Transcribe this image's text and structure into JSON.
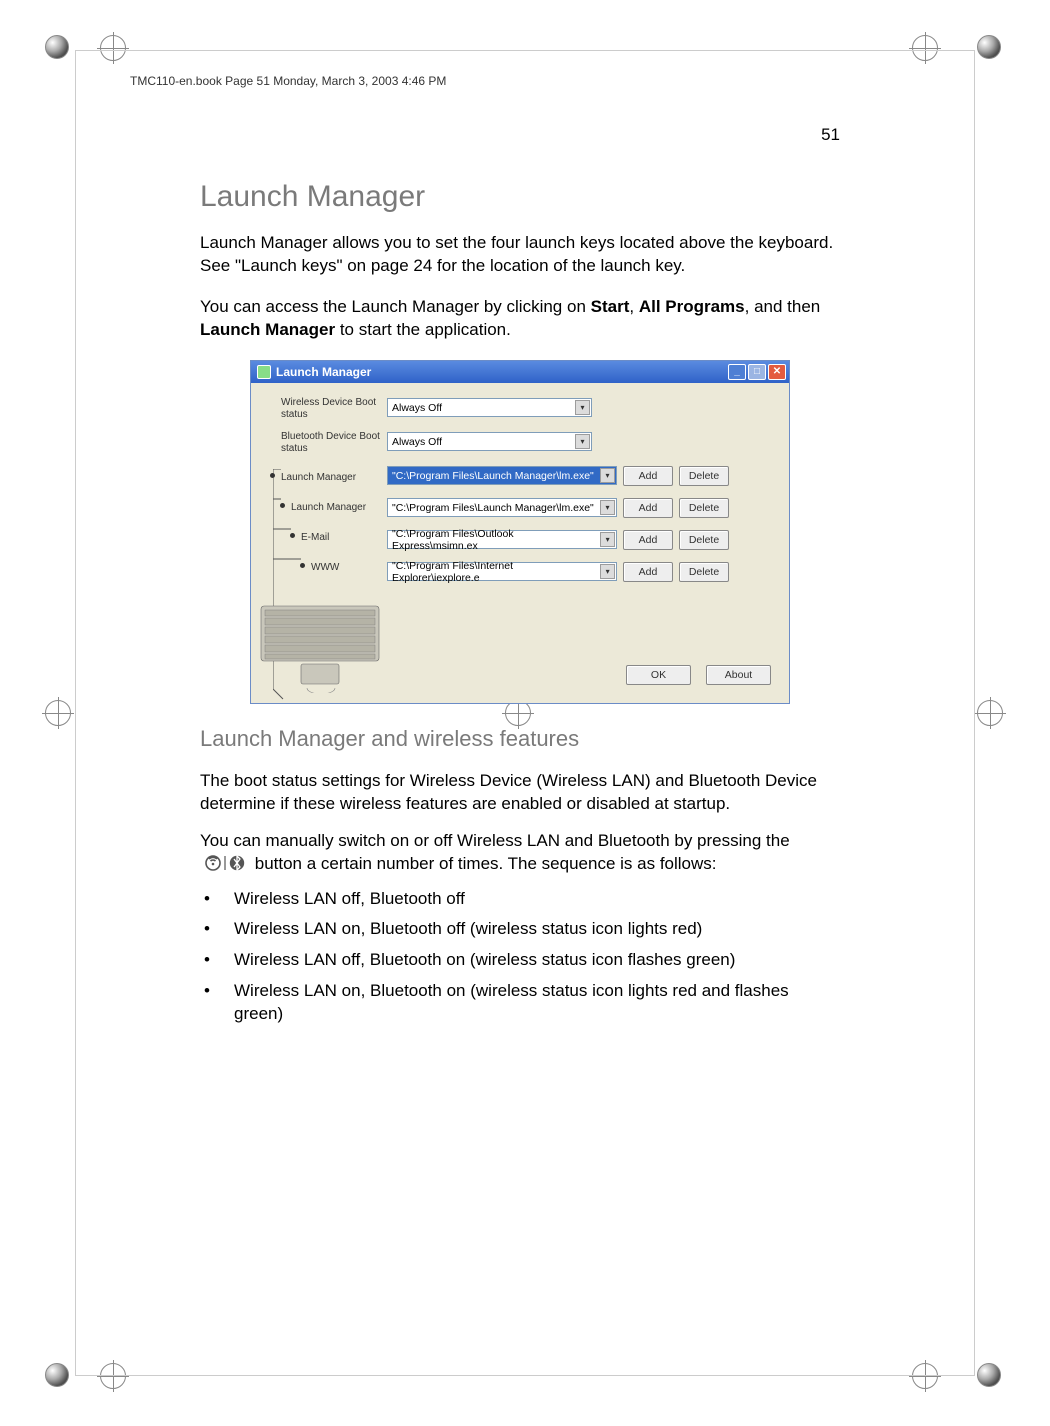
{
  "running_head": "TMC110-en.book  Page 51  Monday, March 3, 2003  4:46 PM",
  "page_number": "51",
  "h1": "Launch Manager",
  "intro_para": "Launch  Manager allows you to set the four launch keys located above the keyboard.  See \"Launch keys\" on page 24 for the location of the launch key.",
  "access_prefix": "You can access the Launch Manager by clicking on ",
  "access_bold1": "Start",
  "access_sep1": ", ",
  "access_bold2": "All Programs",
  "access_sep2": ", and then ",
  "access_bold3": "Launch Manager",
  "access_suffix": " to start the application.",
  "h2": "Launch Manager and wireless features",
  "wireless_para1": "The boot status settings for Wireless Device (Wireless LAN) and Bluetooth Device determine if these wireless features are enabled or disabled at startup.",
  "wireless_para2_prefix": "You can manually switch on or off Wireless LAN and Bluetooth by pressing the ",
  "wireless_para2_suffix": " button a certain number of times. The sequence is as follows:",
  "bullets": [
    "Wireless LAN off, Bluetooth off",
    "Wireless LAN on, Bluetooth off (wireless status icon lights red)",
    "Wireless LAN off, Bluetooth on (wireless status icon flashes green)",
    "Wireless LAN on, Bluetooth on (wireless status icon lights red and flashes green)"
  ],
  "lm": {
    "title": "Launch Manager",
    "labels": {
      "wireless_boot": "Wireless Device Boot status",
      "bt_boot": "Bluetooth Device Boot status",
      "keys": [
        "Launch Manager",
        "Launch Manager",
        "E-Mail",
        "WWW"
      ]
    },
    "combos": {
      "wireless": "Always Off",
      "bt": "Always Off",
      "paths": [
        "\"C:\\Program Files\\Launch Manager\\lm.exe\"",
        "\"C:\\Program Files\\Launch Manager\\lm.exe\"",
        "\"C:\\Program Files\\Outlook Express\\msimn.ex",
        "\"C:\\Program Files\\Internet Explorer\\iexplore.e"
      ]
    },
    "buttons": {
      "add": "Add",
      "delete": "Delete",
      "ok": "OK",
      "about": "About"
    }
  }
}
